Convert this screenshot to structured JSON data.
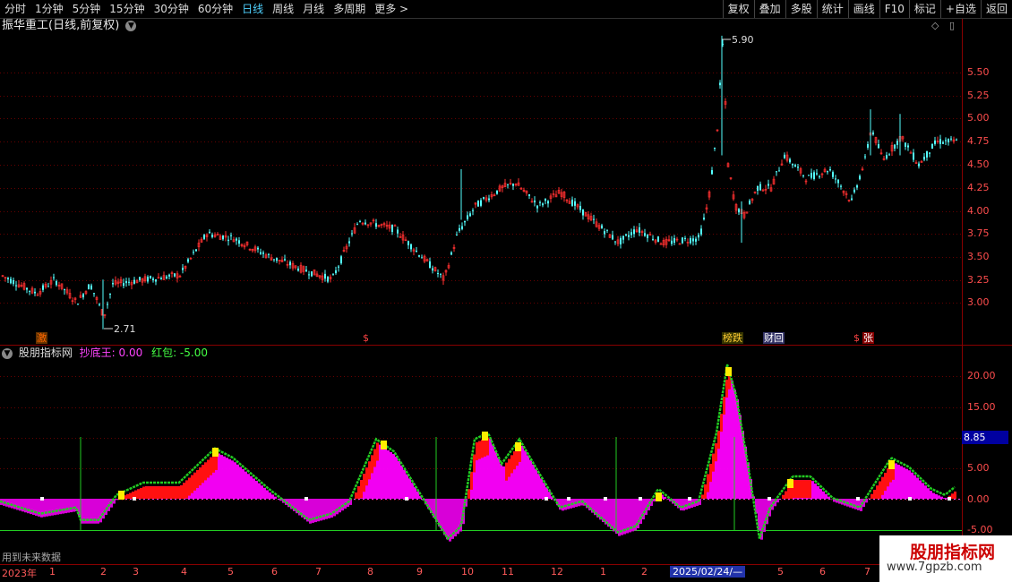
{
  "toolbar": {
    "periods": [
      "分时",
      "1分钟",
      "5分钟",
      "15分钟",
      "30分钟",
      "60分钟",
      "日线",
      "周线",
      "月线",
      "多周期",
      "更多 >"
    ],
    "active_period": "日线",
    "actions": [
      "复权",
      "叠加",
      "多股",
      "统计",
      "画线",
      "F10",
      "标记",
      "+自选",
      "返回"
    ]
  },
  "main_title": "振华重工(日线,前复权)",
  "main_axis": [
    "5.50",
    "5.25",
    "5.00",
    "4.75",
    "4.50",
    "4.25",
    "4.00",
    "3.75",
    "3.50",
    "3.25",
    "3.00"
  ],
  "price_high_label": "5.90",
  "price_low_label": "2.71",
  "event_tags": [
    {
      "text": "激",
      "color": "#ff6600",
      "bg": "#663300"
    },
    {
      "text": "$",
      "color": "#ff4444",
      "bg": "transparent"
    },
    {
      "text": "榜跌",
      "color": "#ffcc33",
      "bg": "#333300"
    },
    {
      "text": "财回",
      "color": "#ffffff",
      "bg": "#333366"
    },
    {
      "text": "$",
      "color": "#ff4444",
      "bg": "transparent"
    },
    {
      "text": "张",
      "color": "#ffffff",
      "bg": "#880000"
    }
  ],
  "indicator": {
    "name": "股朋指标网",
    "k1_label": "抄底王: 0.00",
    "k2_label": "红包: -5.00",
    "axis": [
      "20.00",
      "15.00",
      "10.00",
      "5.00",
      "0.00",
      "-5.00"
    ],
    "highlight_value": "8.85"
  },
  "future_note": "用到未来数据",
  "dates": {
    "year": "2023年",
    "months": [
      "1",
      "2",
      "3",
      "4",
      "5",
      "6",
      "7",
      "8",
      "9",
      "10",
      "11",
      "12",
      "1",
      "2",
      "5",
      "6",
      "7"
    ],
    "selected": "2025/02/24/—"
  },
  "watermark": {
    "line1": "股朋指标网",
    "line2": "www.7gpzb.com"
  },
  "chart_data": {
    "type": "line",
    "title": "振华重工(日线,前复权)",
    "price_range": [
      2.71,
      5.9
    ],
    "key_levels": {
      "high": 5.9,
      "low": 2.71
    },
    "indicator_range": [
      -5,
      22
    ],
    "indicator_series": [
      {
        "name": "抄底王",
        "value": 0.0
      },
      {
        "name": "红包",
        "value": -5.0
      }
    ]
  }
}
